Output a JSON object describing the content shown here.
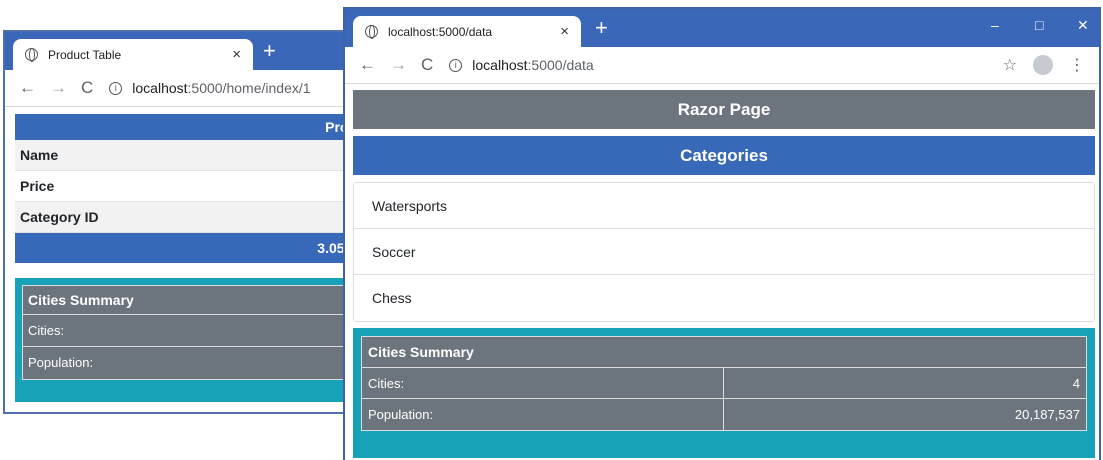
{
  "back_window": {
    "tab_title": "Product Table",
    "tab_close": "×",
    "new_tab": "+",
    "nav": {
      "back": "←",
      "forward": "→",
      "reload": "C"
    },
    "address": {
      "host": "localhost",
      "rest": ":5000/home/index/1"
    },
    "banner": "Prod",
    "rows": [
      "Name",
      "Price",
      "Category ID"
    ],
    "progress_text": "3.05%",
    "summary": {
      "title": "Cities Summary",
      "rows": [
        "Cities:",
        "Population:"
      ]
    }
  },
  "front_window": {
    "tab_title": "localhost:5000/data",
    "tab_close": "×",
    "new_tab": "+",
    "window_controls": {
      "minimize": "–",
      "maximize": "□",
      "close": "✕"
    },
    "nav": {
      "back": "←",
      "forward": "→",
      "reload": "C"
    },
    "address": {
      "host": "localhost",
      "rest": ":5000/data"
    },
    "star": "☆",
    "menu": "⋮",
    "page_header": "Razor Page",
    "categories_header": "Categories",
    "categories": [
      "Watersports",
      "Soccer",
      "Chess"
    ],
    "summary": {
      "title": "Cities Summary",
      "rows": [
        {
          "label": "Cities:",
          "value": "4"
        },
        {
          "label": "Population:",
          "value": "20,187,537"
        }
      ]
    }
  },
  "colors": {
    "chrome_blue": "#3a67b8",
    "primary": "#3769b8",
    "secondary": "#6c757d",
    "info": "#17a2b8"
  },
  "icons": [
    "globe-icon",
    "info-icon",
    "star-icon",
    "avatar",
    "menu-icon"
  ]
}
